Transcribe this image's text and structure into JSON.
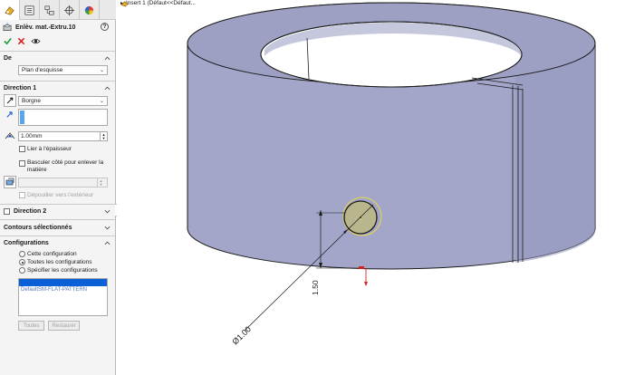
{
  "feature": {
    "title": "Enlèv. mat.-Extru.10",
    "help_icon": "question-icon"
  },
  "from": {
    "label": "De",
    "value": "Plan d'esquisse"
  },
  "direction1": {
    "label": "Direction 1",
    "end_condition": "Borgne",
    "depth": "1.00mm",
    "link_thickness": "Lier à l'épaisseur",
    "flip_side": "Basculer côté pour enlever la matière",
    "draft_outward": "Dépouiller vers l'extérieur"
  },
  "direction2": {
    "label": "Direction 2"
  },
  "contours": {
    "label": "Contours sélectionnés"
  },
  "configurations": {
    "label": "Configurations",
    "options": [
      "Cette configuration",
      "Toutes les configurations",
      "Spécifier les configurations"
    ],
    "selected_index": 1,
    "list": [
      "",
      "DefaultSM-FLAT-PATTERN"
    ],
    "buttons": [
      "Toutes",
      "Restaurer"
    ]
  },
  "viewport": {
    "breadcrumb": "Insert 1  (Défaut<<Défaut...",
    "dim_height": "1.50",
    "dim_diameter": "Ø1.00"
  },
  "colors": {
    "part_face": "#9da0c2",
    "part_side": "#a3a6c9",
    "edge": "#1a1a1a",
    "accent_blue": "#2a6bd6",
    "circle_fill": "#b9b58d",
    "highlight_yellow": "#e7d84a"
  }
}
